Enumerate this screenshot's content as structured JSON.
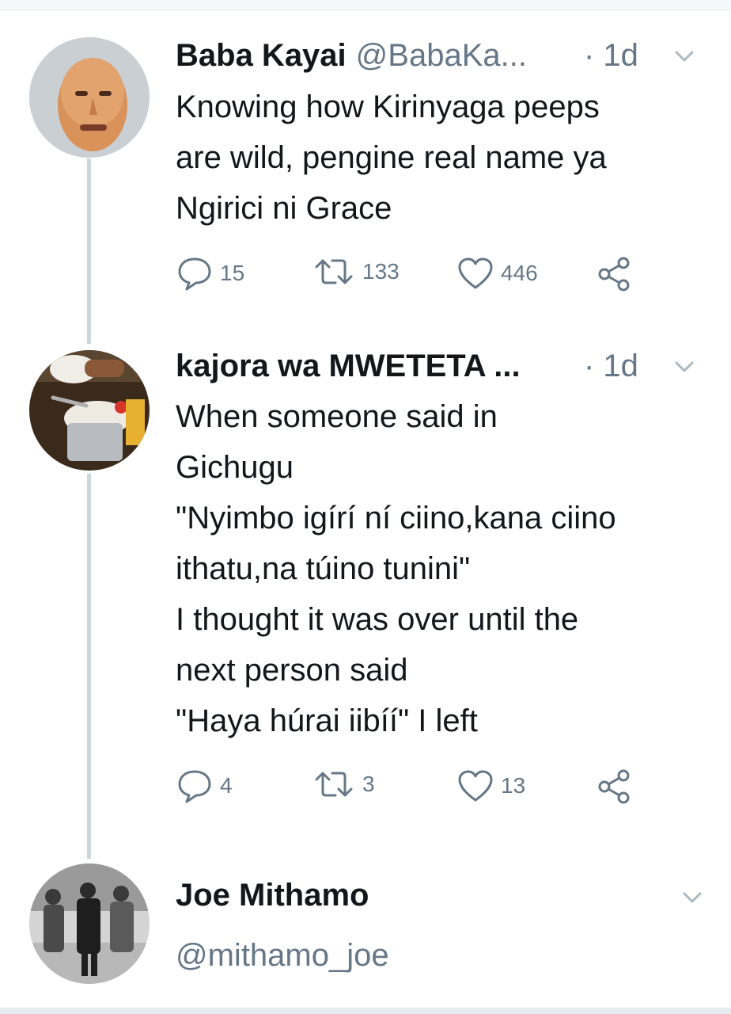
{
  "tweets": [
    {
      "name": "Baba Kayai",
      "handle": "@BabaKa...",
      "time": "· 1d",
      "lines": [
        "Knowing how Kirinyaga peeps",
        "are wild, pengine real name ya",
        "Ngirici ni Grace"
      ],
      "replies": "15",
      "retweets": "133",
      "likes": "446"
    },
    {
      "name": "kajora wa MWETETA ...",
      "time": "· 1d",
      "lines": [
        "When someone said in",
        "Gichugu",
        "\"Nyimbo igírí ní ciino,kana ciino",
        "ithatu,na túino tunini\"",
        "I thought it was over until the",
        "next person said",
        "\"Haya húrai iibíí\" I left"
      ],
      "replies": "4",
      "retweets": "3",
      "likes": "13"
    },
    {
      "name": "Joe Mithamo",
      "handle": "@mithamo_joe"
    }
  ],
  "icons": {
    "reply": "reply-icon",
    "retweet": "retweet-icon",
    "like": "heart-icon",
    "share": "share-icon",
    "caret": "chevron-down-icon"
  },
  "colors": {
    "text": "#14171a",
    "secondary": "#657786",
    "thread_line": "#ccd6dd"
  }
}
